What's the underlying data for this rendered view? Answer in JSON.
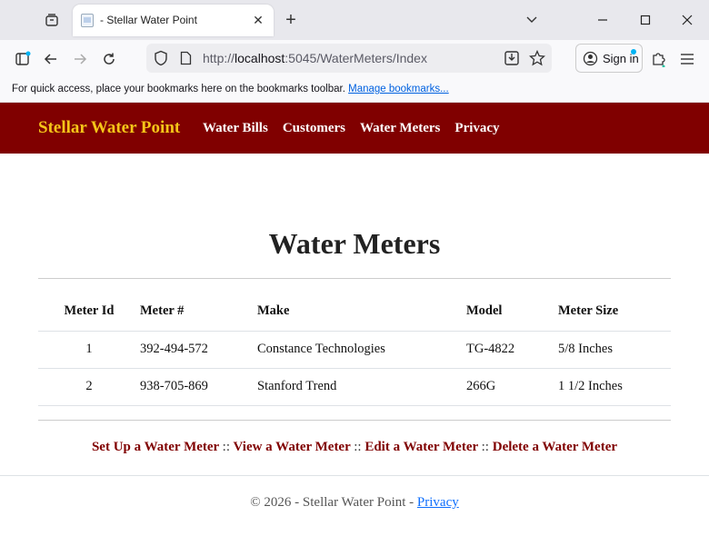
{
  "browser": {
    "tab_title": "- Stellar Water Point",
    "url_prefix": "http://",
    "url_host": "localhost",
    "url_rest": ":5045/WaterMeters/Index",
    "sign_in": "Sign in",
    "bookmarks_msg": "For quick access, place your bookmarks here on the bookmarks toolbar.",
    "manage_bookmarks": "Manage bookmarks..."
  },
  "site": {
    "brand": "Stellar Water Point",
    "nav": [
      "Water Bills",
      "Customers",
      "Water Meters",
      "Privacy"
    ],
    "colors": {
      "header": "#800000",
      "brand": "#f5c518",
      "link": "#800000"
    }
  },
  "page": {
    "title": "Water Meters",
    "columns": [
      "Meter Id",
      "Meter #",
      "Make",
      "Model",
      "Meter Size"
    ],
    "rows": [
      [
        "1",
        "392-494-572",
        "Constance Technologies",
        "TG-4822",
        "5/8 Inches"
      ],
      [
        "2",
        "938-705-869",
        "Stanford Trend",
        "266G",
        "1 1/2 Inches"
      ]
    ],
    "actions": [
      "Set Up a Water Meter",
      "View a Water Meter",
      "Edit a Water Meter",
      "Delete a Water Meter"
    ],
    "separator": "::"
  },
  "footer": {
    "text": "© 2026 - Stellar Water Point -",
    "privacy": "Privacy"
  }
}
